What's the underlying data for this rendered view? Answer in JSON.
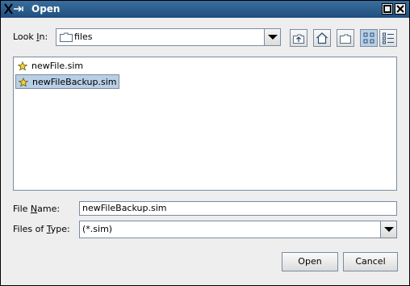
{
  "window": {
    "title": "Open"
  },
  "look_in": {
    "label_pre": "Look ",
    "label_mnemonic": "I",
    "label_post": "n:",
    "value": "files"
  },
  "toolbar": {
    "buttons": [
      "up-one-level-icon",
      "home-icon",
      "new-folder-icon",
      "list-view-icon",
      "details-view-icon"
    ]
  },
  "files": [
    {
      "name": "newFile.sim",
      "selected": false
    },
    {
      "name": "newFileBackup.sim",
      "selected": true
    }
  ],
  "file_name": {
    "label_pre": "File ",
    "label_mnemonic": "N",
    "label_post": "ame:",
    "value": "newFileBackup.sim"
  },
  "files_of_type": {
    "label_pre": "Files of ",
    "label_mnemonic": "T",
    "label_post": "ype:",
    "value": "(*.sim)"
  },
  "actions": {
    "open_label": "Open",
    "cancel_label": "Cancel"
  }
}
